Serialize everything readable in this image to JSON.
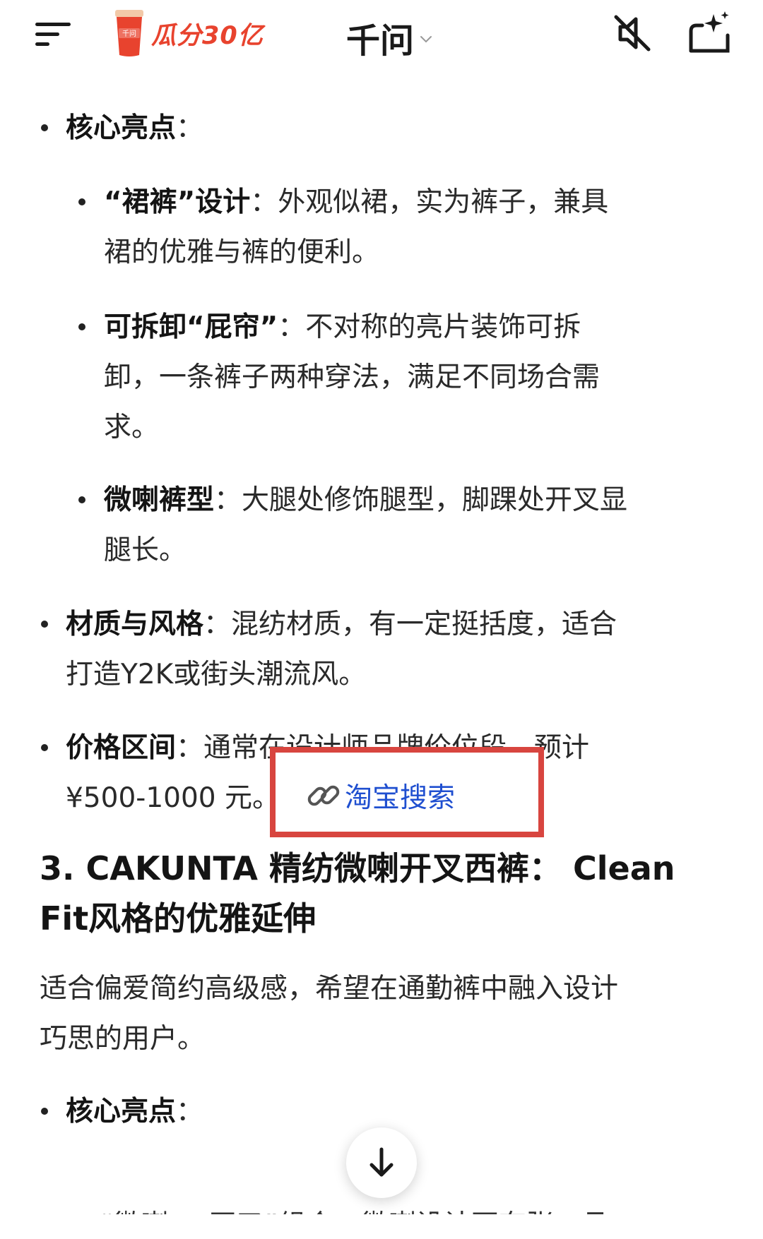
{
  "header": {
    "promo_text": "瓜分30亿",
    "cup_label": "千问",
    "title": "千问",
    "icons": [
      "menu-icon",
      "mute-icon",
      "new-chat-sparkle-icon",
      "chevron-down-icon"
    ]
  },
  "item1": {
    "label": "核心亮点",
    "colon": "："
  },
  "sub1": {
    "label": "“裙裤”设计",
    "colon": "：",
    "line1": "外观似裙，实为裤子，兼具",
    "line2": "裙的优雅与裤的便利。"
  },
  "sub2": {
    "label": "可拆卸“屁帘”",
    "colon": "：",
    "line1": "不对称的亮片装饰可拆",
    "line2": "卸，一条裤子两种穿法，满足不同场合需",
    "line3": "求。"
  },
  "sub3": {
    "label": "微喇裤型",
    "colon": "：",
    "line1": "大腿处修饰腿型，脚踝处开叉显",
    "line2": "腿长。"
  },
  "item2": {
    "label": "材质与风格",
    "colon": "：",
    "line1": "混纺材质，有一定挺括度，适合",
    "line2": "打造Y2K或街头潮流风。"
  },
  "item3": {
    "label": "价格区间",
    "colon": "：",
    "line1": "通常在设计师品牌价位段，预计",
    "line2": "¥500-1000 元。",
    "link": "淘宝搜索"
  },
  "section3": {
    "title_line1": "3. CAKUNTA 精纺微喇开叉西裤： Clean",
    "title_line2": "Fit风格的优雅延伸"
  },
  "intro": {
    "line1": "适合偏爱简约高级感，希望在通勤裤中融入设计",
    "line2": "巧思的用户。"
  },
  "item4": {
    "label": "核心亮点",
    "colon": "："
  },
  "cutoff": {
    "text": "“微喇 + 开叉”组合：微喇设计不夸张，且"
  },
  "colors": {
    "accent": "#e8432e",
    "link": "#1f4fd0",
    "highlight": "#d8453f"
  }
}
